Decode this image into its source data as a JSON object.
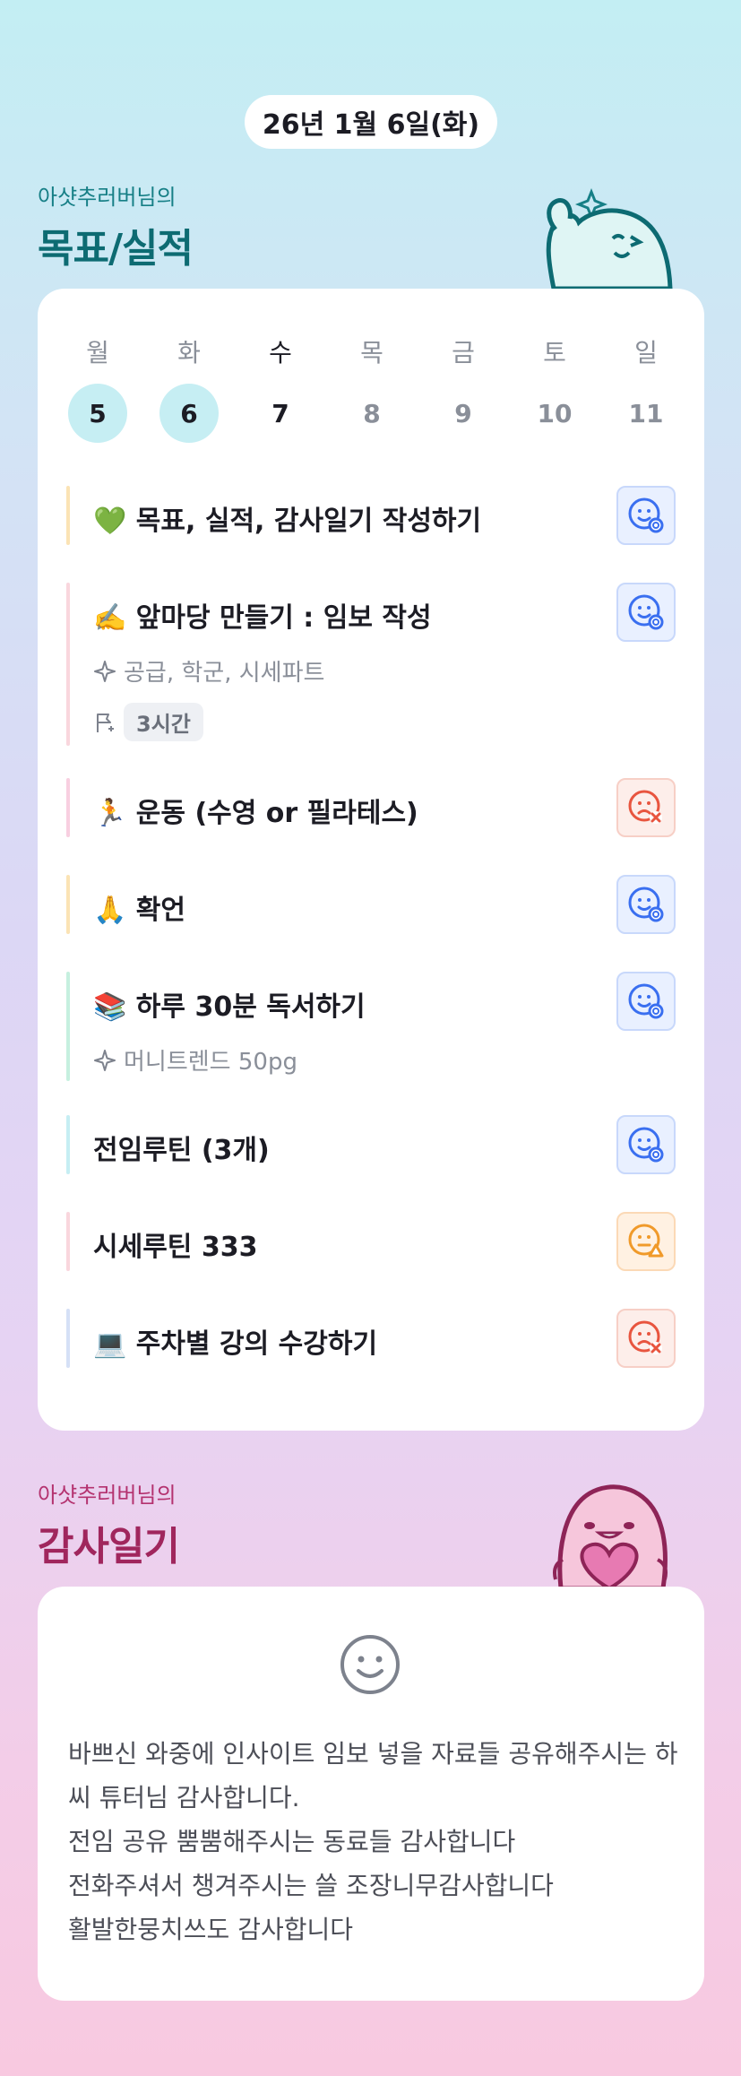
{
  "date": "26년 1월 6일(화)",
  "goals_section": {
    "subtitle": "아샷추러버님의",
    "title": "목표/실적"
  },
  "week": [
    {
      "weekday": "월",
      "day": "5",
      "state": "done"
    },
    {
      "weekday": "화",
      "day": "6",
      "state": "done"
    },
    {
      "weekday": "수",
      "day": "7",
      "state": "today"
    },
    {
      "weekday": "목",
      "day": "8",
      "state": "future"
    },
    {
      "weekday": "금",
      "day": "9",
      "state": "future"
    },
    {
      "weekday": "토",
      "day": "10",
      "state": "future"
    },
    {
      "weekday": "일",
      "day": "11",
      "state": "future"
    }
  ],
  "goals": [
    {
      "title": "💚 목표, 실적, 감사일기 작성하기",
      "bar_color": "#fbe3b5",
      "status": "ok",
      "status_icon": "happy-face-icon"
    },
    {
      "title": "✍️ 앞마당 만들기 : 임보 작성",
      "detail": "공급, 학군, 시세파트",
      "time": "3시간",
      "bar_color": "#f9d6dd",
      "status": "ok",
      "status_icon": "happy-face-icon"
    },
    {
      "title": "🏃 운동 (수영 or 필라테스)",
      "bar_color": "#f8cfe0",
      "status": "fail",
      "status_icon": "sad-face-icon"
    },
    {
      "title": "🙏 확언",
      "bar_color": "#fbe3b5",
      "status": "ok",
      "status_icon": "happy-face-icon"
    },
    {
      "title": "📚 하루 30분 독서하기",
      "detail": "머니트렌드 50pg",
      "bar_color": "#c6f0df",
      "status": "ok",
      "status_icon": "happy-face-icon"
    },
    {
      "title": "전임루틴 (3개)",
      "bar_color": "#c6eef3",
      "status": "ok",
      "status_icon": "happy-face-icon"
    },
    {
      "title": "시세루틴 333",
      "bar_color": "#f9d6dd",
      "status": "warn",
      "status_icon": "neutral-face-icon"
    },
    {
      "title": "💻 주차별 강의 수강하기",
      "bar_color": "#d5e0f6",
      "status": "fail",
      "status_icon": "sad-face-icon"
    }
  ],
  "thanks_section": {
    "subtitle": "아샷추러버님의",
    "title": "감사일기"
  },
  "thanks_text": "바쁘신 와중에 인사이트 임보 넣을 자료들 공유해주시는 하씨 튜터님 감사합니다.\n전임 공유 뿜뿜해주시는 동료들 감사합니다\n전화주셔서 챙겨주시는 쓸 조장니무감사합니다\n활발한뭉치쓰도 감사합니다",
  "colors": {
    "ok": "#3a6ff0",
    "fail": "#e8553f",
    "warn": "#f09a2a",
    "goal_accent": "#0d6b72",
    "thanks_accent": "#a0265d"
  }
}
